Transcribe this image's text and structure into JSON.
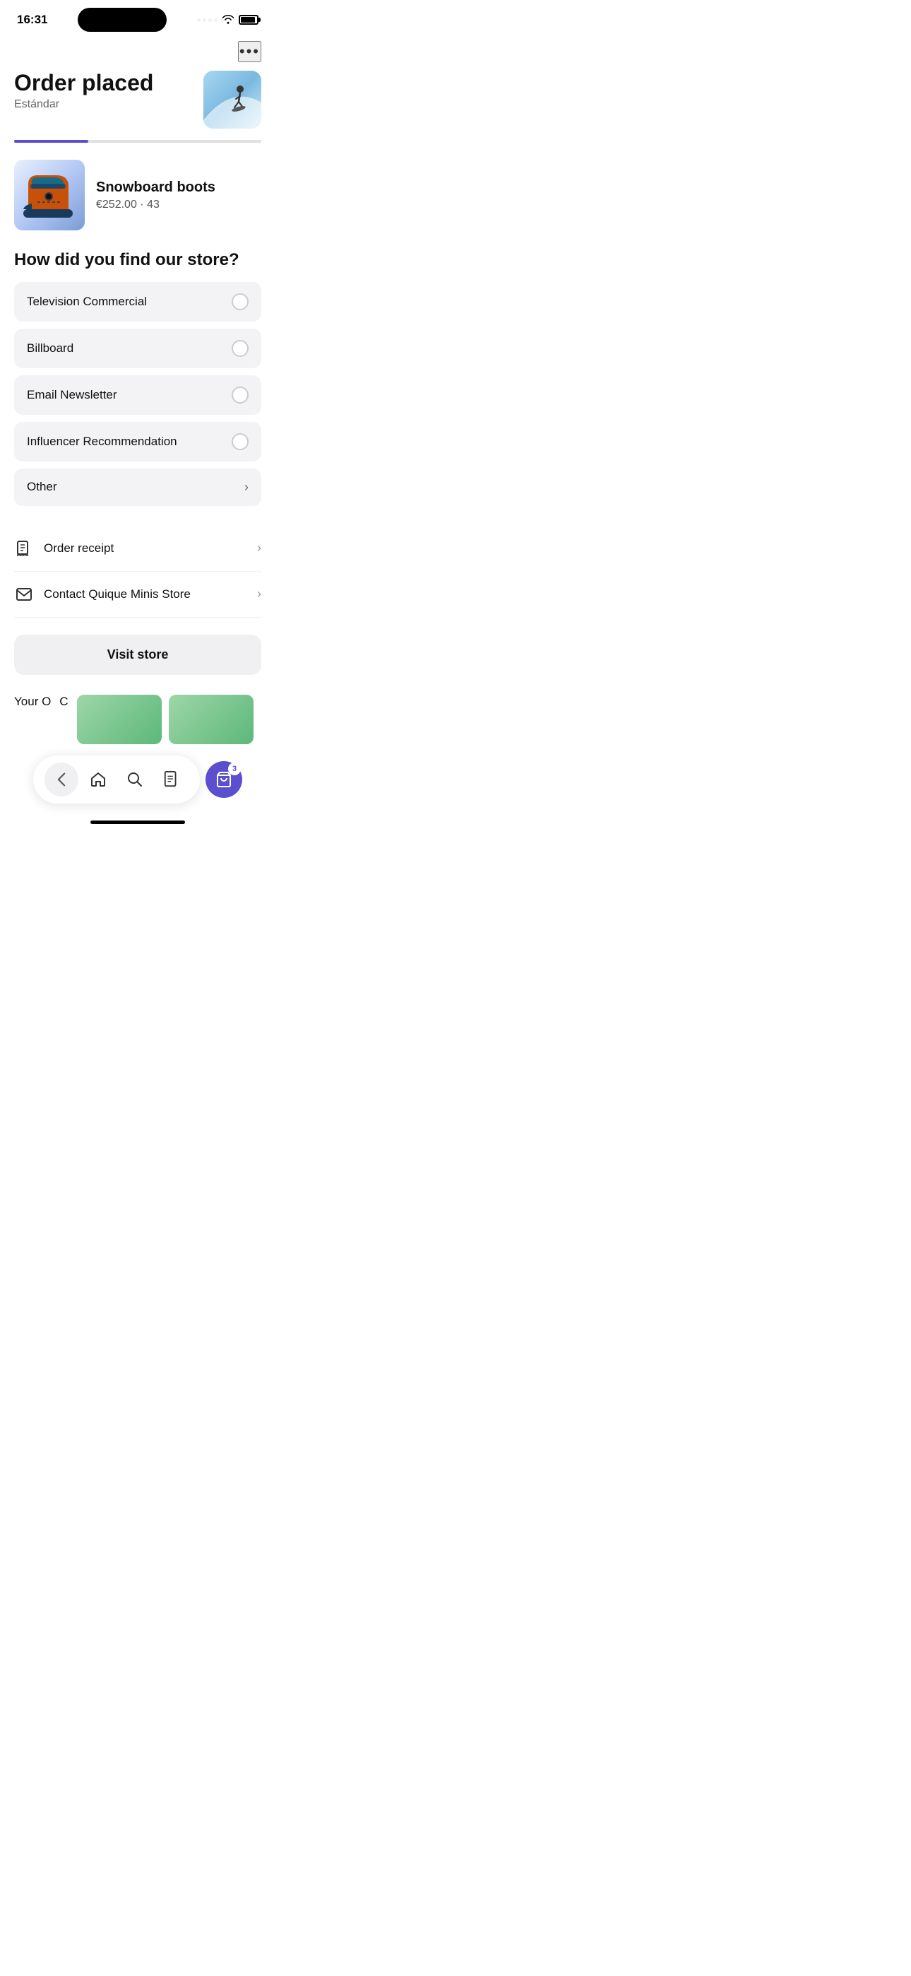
{
  "status": {
    "time": "16:31",
    "wifi": "wifi",
    "battery": "battery"
  },
  "header": {
    "more_label": "•••",
    "title": "Order placed",
    "subtitle": "Estándar",
    "progress_percent": 30
  },
  "product": {
    "name": "Snowboard boots",
    "price": "€252.00",
    "size": "43",
    "details": "€252.00 · 43"
  },
  "survey": {
    "question": "How did you find our store?",
    "options": [
      {
        "id": "tv",
        "label": "Television Commercial",
        "type": "radio"
      },
      {
        "id": "billboard",
        "label": "Billboard",
        "type": "radio"
      },
      {
        "id": "email",
        "label": "Email Newsletter",
        "type": "radio"
      },
      {
        "id": "influencer",
        "label": "Influencer Recommendation",
        "type": "radio"
      },
      {
        "id": "other",
        "label": "Other",
        "type": "chevron"
      }
    ]
  },
  "actions": [
    {
      "id": "receipt",
      "label": "Order receipt",
      "icon": "receipt"
    },
    {
      "id": "contact",
      "label": "Contact Quique Minis Store",
      "icon": "email"
    }
  ],
  "visit_store_btn": "Visit store",
  "bottom_peek": {
    "text": "Your O"
  },
  "nav": {
    "back": "‹",
    "home": "⌂",
    "search": "○",
    "receipt": "▤",
    "cart_count": "3"
  }
}
